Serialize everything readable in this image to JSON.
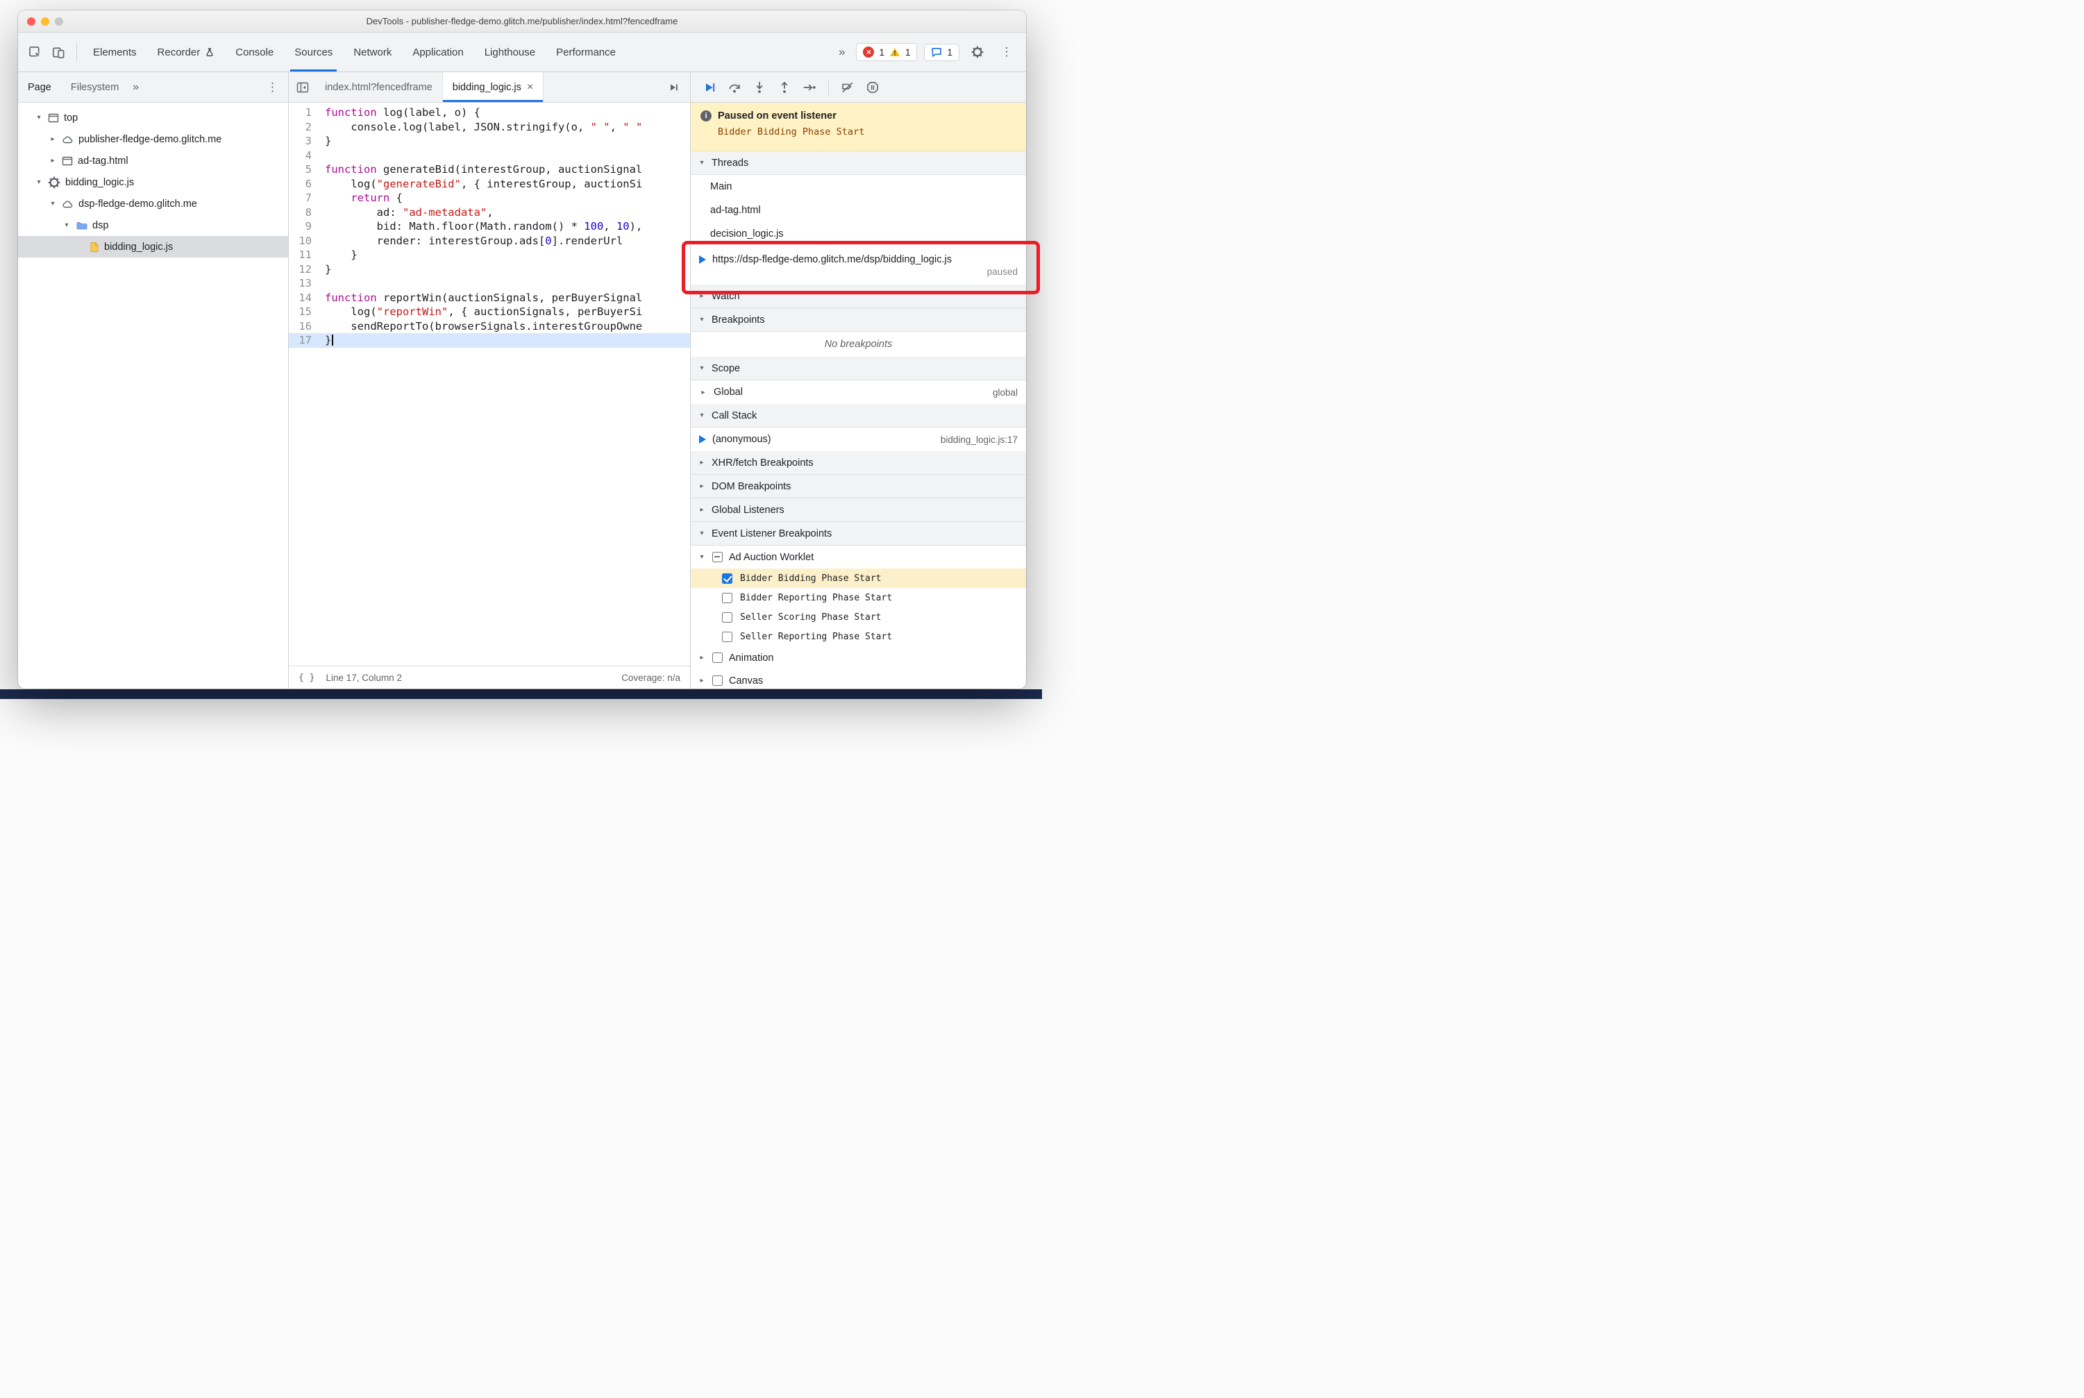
{
  "window": {
    "title": "DevTools - publisher-fledge-demo.glitch.me/publisher/index.html?fencedframe"
  },
  "main_toolbar": {
    "more_glyph": "»",
    "tabs": [
      {
        "label": "Elements"
      },
      {
        "label": "Recorder",
        "icon": "flask-icon"
      },
      {
        "label": "Console"
      },
      {
        "label": "Sources",
        "active": true
      },
      {
        "label": "Network"
      },
      {
        "label": "Application"
      },
      {
        "label": "Lighthouse"
      },
      {
        "label": "Performance"
      }
    ],
    "badges": {
      "errors": "1",
      "warnings": "1",
      "issues": "1"
    }
  },
  "navigator": {
    "tabs": [
      {
        "label": "Page",
        "active": true
      },
      {
        "label": "Filesystem"
      }
    ],
    "more_glyph": "»",
    "menu_glyph": "⋮",
    "tree": [
      {
        "label": "top",
        "icon": "frame",
        "expander": "open",
        "depth": 0
      },
      {
        "label": "publisher-fledge-demo.glitch.me",
        "icon": "cloud",
        "expander": "closed",
        "depth": 1
      },
      {
        "label": "ad-tag.html",
        "icon": "frame",
        "expander": "closed",
        "depth": 1
      },
      {
        "label": "bidding_logic.js",
        "icon": "gear",
        "expander": "open",
        "depth": 0
      },
      {
        "label": "dsp-fledge-demo.glitch.me",
        "icon": "cloud",
        "expander": "open",
        "depth": 1
      },
      {
        "label": "dsp",
        "icon": "folder",
        "expander": "open",
        "depth": 2
      },
      {
        "label": "bidding_logic.js",
        "icon": "file",
        "expander": "none",
        "depth": 3,
        "selected": true
      }
    ]
  },
  "editor": {
    "tabs": [
      {
        "label": "index.html?fencedframe"
      },
      {
        "label": "bidding_logic.js",
        "active": true,
        "closable": true
      }
    ],
    "status_braces": "{ }",
    "status_left": "Line 17, Column 2",
    "status_right": "Coverage: n/a",
    "code": [
      {
        "n": 1,
        "segs": [
          [
            "k",
            "function"
          ],
          [
            "p",
            " log(label, o) {"
          ]
        ]
      },
      {
        "n": 2,
        "segs": [
          [
            "p",
            "    console.log(label, JSON.stringify(o, "
          ],
          [
            "s",
            "\" \""
          ],
          [
            "p",
            ", "
          ],
          [
            "s",
            "\" \""
          ]
        ]
      },
      {
        "n": 3,
        "segs": [
          [
            "p",
            "}"
          ]
        ]
      },
      {
        "n": 4,
        "segs": []
      },
      {
        "n": 5,
        "segs": [
          [
            "k",
            "function"
          ],
          [
            "p",
            " generateBid(interestGroup, auctionSignal"
          ]
        ]
      },
      {
        "n": 6,
        "segs": [
          [
            "p",
            "    log("
          ],
          [
            "s",
            "\"generateBid\""
          ],
          [
            "p",
            ", { interestGroup, auctionSi"
          ]
        ]
      },
      {
        "n": 7,
        "segs": [
          [
            "p",
            "    "
          ],
          [
            "k",
            "return"
          ],
          [
            "p",
            " {"
          ]
        ]
      },
      {
        "n": 8,
        "segs": [
          [
            "p",
            "        ad: "
          ],
          [
            "s",
            "\"ad-metadata\""
          ],
          [
            "p",
            ","
          ]
        ]
      },
      {
        "n": 9,
        "segs": [
          [
            "p",
            "        bid: Math.floor(Math.random() * "
          ],
          [
            "n2",
            "100"
          ],
          [
            "p",
            ", "
          ],
          [
            "n2",
            "10"
          ],
          [
            "p",
            "),"
          ]
        ]
      },
      {
        "n": 10,
        "segs": [
          [
            "p",
            "        render: interestGroup.ads["
          ],
          [
            "n2",
            "0"
          ],
          [
            "p",
            "].renderUrl"
          ]
        ]
      },
      {
        "n": 11,
        "segs": [
          [
            "p",
            "    }"
          ]
        ]
      },
      {
        "n": 12,
        "segs": [
          [
            "p",
            "}"
          ]
        ]
      },
      {
        "n": 13,
        "segs": []
      },
      {
        "n": 14,
        "segs": [
          [
            "k",
            "function"
          ],
          [
            "p",
            " reportWin(auctionSignals, perBuyerSignal"
          ]
        ]
      },
      {
        "n": 15,
        "segs": [
          [
            "p",
            "    log("
          ],
          [
            "s",
            "\"reportWin\""
          ],
          [
            "p",
            ", { auctionSignals, perBuyerSi"
          ]
        ]
      },
      {
        "n": 16,
        "segs": [
          [
            "p",
            "    sendReportTo(browserSignals.interestGroupOwne"
          ]
        ]
      },
      {
        "n": 17,
        "segs": [
          [
            "p",
            "}"
          ]
        ],
        "hl": true,
        "cursor": true
      }
    ]
  },
  "debugger": {
    "toolbar_icons": [
      "resume-icon",
      "step-over-icon",
      "step-into-icon",
      "step-out-icon",
      "step-icon",
      "separator",
      "deactivate-breakpoints-icon",
      "pause-on-exceptions-icon"
    ],
    "banner": {
      "title": "Paused on event listener",
      "event": "Bidder Bidding Phase Start"
    },
    "threads": {
      "title": "Threads",
      "exp": "▾",
      "items": [
        {
          "label": "Main"
        },
        {
          "label": "ad-tag.html"
        },
        {
          "label": "decision_logic.js"
        },
        {
          "label": "https://dsp-fledge-demo.glitch.me/dsp/bidding_logic.js",
          "current": true,
          "status": "paused"
        }
      ]
    },
    "watch": {
      "title": "Watch",
      "exp": "▸"
    },
    "breakpoints": {
      "title": "Breakpoints",
      "exp": "▾",
      "empty": "No breakpoints"
    },
    "scope": {
      "title": "Scope",
      "exp": "▾",
      "items": [
        {
          "label": "Global",
          "exp": "▸",
          "value": "global"
        }
      ]
    },
    "call_stack": {
      "title": "Call Stack",
      "exp": "▾",
      "items": [
        {
          "label": "(anonymous)",
          "location": "bidding_logic.js:17",
          "current": true
        }
      ]
    },
    "xhr_breakpoints": {
      "title": "XHR/fetch Breakpoints",
      "exp": "▸"
    },
    "dom_breakpoints": {
      "title": "DOM Breakpoints",
      "exp": "▸"
    },
    "global_listeners": {
      "title": "Global Listeners",
      "exp": "▸"
    },
    "event_listener_breakpoints": {
      "title": "Event Listener Breakpoints",
      "exp": "▾",
      "groups": [
        {
          "label": "Ad Auction Worklet",
          "state": "indeterminate",
          "expanded": true,
          "items": [
            {
              "label": "Bidder Bidding Phase Start",
              "checked": true,
              "highlight": true
            },
            {
              "label": "Bidder Reporting Phase Start",
              "checked": false
            },
            {
              "label": "Seller Scoring Phase Start",
              "checked": false
            },
            {
              "label": "Seller Reporting Phase Start",
              "checked": false
            }
          ]
        },
        {
          "label": "Animation",
          "state": "unchecked",
          "expanded": false,
          "items": []
        },
        {
          "label": "Canvas",
          "state": "unchecked",
          "expanded": false,
          "items": []
        }
      ]
    }
  },
  "annotation": {
    "color": "#ee1c25"
  },
  "colors": {
    "accent": "#1a73e8",
    "paused_banner": "#fff2c5",
    "selection": "#d7e7fd",
    "bottom_strip": "#1c2a4d"
  }
}
